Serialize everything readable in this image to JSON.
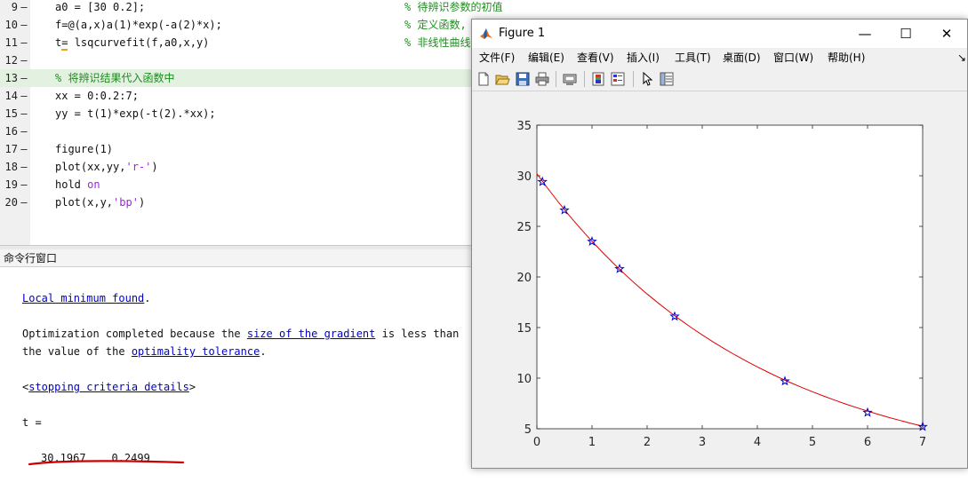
{
  "editor": {
    "lines": [
      {
        "num": "9",
        "code": "a0 = [30 0.2];",
        "comment": "% 待辨识参数的初值"
      },
      {
        "num": "10",
        "code": "f=@(a,x)a(1)*exp(-a(2)*x);",
        "comment": "% 定义函数,"
      },
      {
        "num": "11",
        "code_pre": "t",
        "code_cursor": "=",
        "code_post": " lsqcurvefit(f,a0,x,y)",
        "comment": "% 非线性曲线"
      },
      {
        "num": "12",
        "code": ""
      },
      {
        "num": "13",
        "full_comment": "% 将辨识结果代入函数中"
      },
      {
        "num": "14",
        "code": "xx = 0:0.2:7;"
      },
      {
        "num": "15",
        "code": "yy = t(1)*exp(-t(2).*xx);"
      },
      {
        "num": "16",
        "code": ""
      },
      {
        "num": "17",
        "code": "figure(1)"
      },
      {
        "num": "18",
        "code_pre": "plot(xx,yy,",
        "code_str": "'r-'",
        "code_post": ")"
      },
      {
        "num": "19",
        "code_pre": "hold ",
        "code_kw": "on"
      },
      {
        "num": "20",
        "code_pre": "plot(x,y,",
        "code_str": "'bp'",
        "code_post": ")"
      }
    ],
    "dash": "–"
  },
  "command_window": {
    "title": "命令行窗口",
    "line1_link": "Local minimum found",
    "line1_tail": ".",
    "line2_pre": "Optimization completed because the ",
    "line2_link": "size of the gradient",
    "line2_post": " is less than",
    "line3_pre": "the value of the ",
    "line3_link": "optimality tolerance",
    "line3_post": ".",
    "line4_pre": "<",
    "line4_link": "stopping criteria details",
    "line4_post": ">",
    "result_label": "t =",
    "result_values": "30.1967    0.2499"
  },
  "figure": {
    "title": "Figure 1",
    "window_buttons": {
      "minimize": "—",
      "maximize": "☐",
      "close": "✕"
    },
    "menu": [
      "文件(F)",
      "编辑(E)",
      "查看(V)",
      "插入(I)",
      "工具(T)",
      "桌面(D)",
      "窗口(W)",
      "帮助(H)"
    ],
    "menu_overflow": "↘",
    "toolbar_icons": [
      "new-figure-icon",
      "open-file-icon",
      "save-icon",
      "print-icon",
      "link-plot-icon",
      "insert-colorbar-icon",
      "insert-legend-icon",
      "edit-plot-icon",
      "property-inspector-icon"
    ]
  },
  "colors": {
    "fit_line": "#e00000",
    "markers": "#0000cc",
    "comment": "#228b22",
    "highlight": "#e3f1e1"
  },
  "chart_data": {
    "type": "line",
    "title": "",
    "xlabel": "",
    "ylabel": "",
    "xlim": [
      0,
      7
    ],
    "ylim": [
      5,
      35
    ],
    "xticks": [
      "0",
      "1",
      "2",
      "3",
      "4",
      "5",
      "6",
      "7"
    ],
    "yticks": [
      "5",
      "10",
      "15",
      "20",
      "25",
      "30",
      "35"
    ],
    "grid": false,
    "fit_params": [
      30.1967,
      0.2499
    ],
    "series": [
      {
        "style": "red-line",
        "x_start": 0,
        "x_end": 7,
        "x_step": 0.2
      },
      {
        "style": "blue-star",
        "x": [
          0.1,
          0.5,
          1,
          1.5,
          2.5,
          4.5,
          6,
          7
        ],
        "y": [
          29.4,
          26.6,
          23.5,
          20.8,
          16.1,
          9.7,
          6.6,
          5.2
        ]
      }
    ]
  }
}
